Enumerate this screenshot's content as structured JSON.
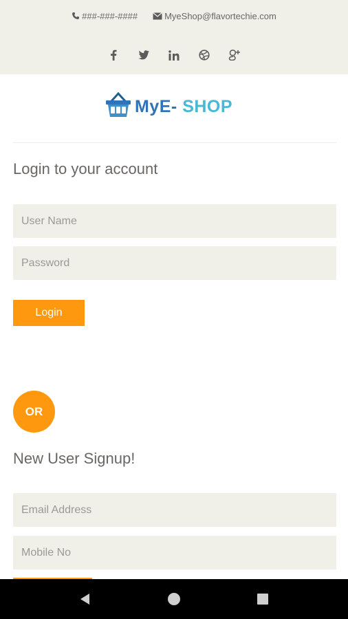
{
  "header": {
    "phone": "###-###-####",
    "email": "MyeShop@flavortechie.com",
    "social": [
      {
        "name": "facebook-icon",
        "glyph": "f"
      },
      {
        "name": "twitter-icon",
        "glyph": "twitter"
      },
      {
        "name": "linkedin-icon",
        "glyph": "in"
      },
      {
        "name": "dribbble-icon",
        "glyph": "dribbble"
      },
      {
        "name": "google-plus-icon",
        "glyph": "g+"
      }
    ]
  },
  "logo": {
    "part1": "MyE-",
    "part2": "SHOP",
    "colors": {
      "primary": "#2f74b8",
      "secondary": "#48b8d6"
    }
  },
  "login": {
    "title": "Login to your account",
    "username_placeholder": "User Name",
    "password_placeholder": "Password",
    "button_label": "Login"
  },
  "or_label": "OR",
  "signup": {
    "title": "New User Signup!",
    "email_placeholder": "Email Address",
    "mobile_placeholder": "Mobile No"
  },
  "colors": {
    "accent": "#fe980f",
    "field_bg": "#f0f0e9",
    "text": "#696763"
  }
}
